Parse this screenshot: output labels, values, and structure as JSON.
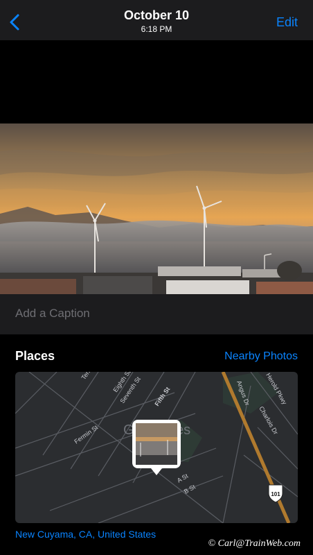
{
  "header": {
    "back_icon": "chevron-left-icon",
    "title": "October 10",
    "subtitle": "6:18 PM",
    "edit_label": "Edit",
    "accent": "#0a84ff"
  },
  "caption": {
    "placeholder": "Add a Caption"
  },
  "places": {
    "heading": "Places",
    "nearby_label": "Nearby Photos",
    "location": "New Cuyama, CA, United States"
  },
  "map": {
    "streets": [
      "Eighth St",
      "Seventh St",
      "Fifth St",
      "Fermin St",
      "Angus Dr",
      "Herold Pkwy",
      "Charlois Dr",
      "A St",
      "B St"
    ],
    "town_label": "G",
    "town_label_end": "es",
    "partial_label": "Ten",
    "highway_shield": "101"
  },
  "watermark": "© Carl@TrainWeb.com"
}
